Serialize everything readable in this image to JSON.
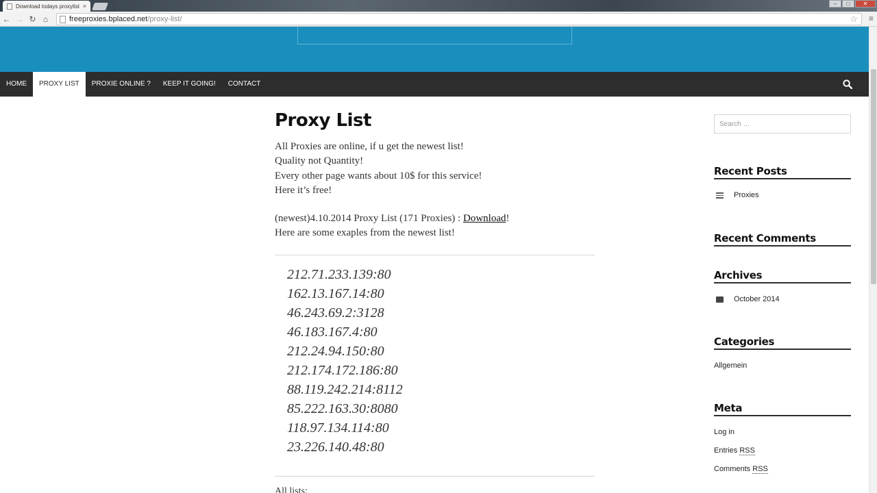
{
  "browser": {
    "tab_title": "Download todays proxylist",
    "tab_close": "×",
    "url_host": "freeproxies.bplaced.net",
    "url_path": "/proxy-list/"
  },
  "nav": {
    "items": [
      "HOME",
      "PROXY LIST",
      "PROXIE ONLINE ?",
      "KEEP IT GOING!",
      "CONTACT"
    ],
    "active_index": 1
  },
  "page": {
    "title": "Proxy List",
    "intro": [
      "All Proxies are online, if u get the newest list!",
      "Quality not Quantity!",
      "Every other page wants about 10$ for this service!",
      "Here it’s free!"
    ],
    "download_prefix": "(newest)4.10.2014 Proxy List (171 Proxies) : ",
    "download_link": "Download",
    "download_suffix": "!",
    "examples_text": "Here are some exaples from the newest list!",
    "proxies": [
      "212.71.233.139:80",
      "162.13.167.14:80",
      "46.243.69.2:3128",
      "46.183.167.4:80",
      "212.24.94.150:80",
      "212.174.172.186:80",
      "88.119.242.214:8112",
      "85.222.163.30:8080",
      "118.97.134.114:80",
      "23.226.140.48:80"
    ],
    "all_lists": "All lists:"
  },
  "sidebar": {
    "search_placeholder": "Search …",
    "recent_posts_title": "Recent Posts",
    "recent_posts": [
      "Proxies"
    ],
    "recent_comments_title": "Recent Comments",
    "archives_title": "Archives",
    "archives": [
      "October 2014"
    ],
    "categories_title": "Categories",
    "categories": [
      "Allgemein"
    ],
    "meta_title": "Meta",
    "meta_login": "Log in",
    "meta_entries": "Entries",
    "meta_comments": "Comments",
    "meta_rss": "RSS"
  },
  "colors": {
    "header_blue": "#1a8fbe",
    "nav_dark": "#2d2d2d"
  }
}
